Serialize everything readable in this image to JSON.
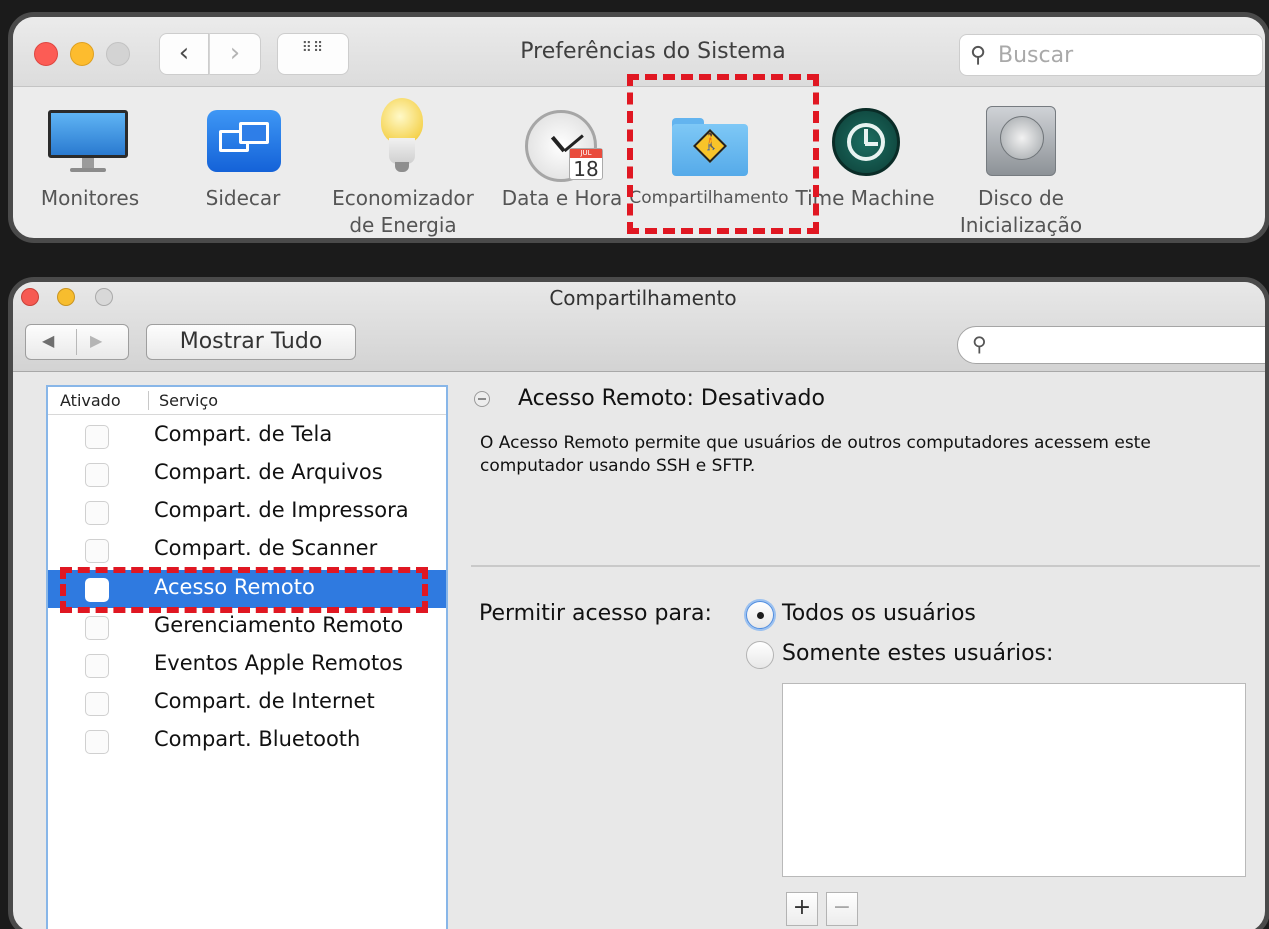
{
  "system_prefs": {
    "title": "Preferências do Sistema",
    "search_placeholder": "Buscar",
    "nav_back": "‹",
    "nav_forward": "›",
    "grid_glyph": "⠿⠿",
    "items": [
      {
        "label": "Monitores"
      },
      {
        "label": "Sidecar"
      },
      {
        "label": "Economizador de Energia"
      },
      {
        "label": "Data e Hora",
        "calendar_month": "JUL",
        "calendar_day": "18"
      },
      {
        "label": "Compartilhamento"
      },
      {
        "label": "Time Machine"
      },
      {
        "label": "Disco de Inicialização"
      }
    ]
  },
  "sharing_window": {
    "title": "Compartilhamento",
    "show_all": "Mostrar Tudo",
    "back_arrow": "◀",
    "forward_arrow": "▶",
    "columns": {
      "enabled": "Ativado",
      "service": "Serviço"
    },
    "services": [
      {
        "label": "Compart. de Tela",
        "checked": false
      },
      {
        "label": "Compart. de Arquivos",
        "checked": false
      },
      {
        "label": "Compart. de Impressora",
        "checked": false
      },
      {
        "label": "Compart. de Scanner",
        "checked": false
      },
      {
        "label": "Acesso Remoto",
        "checked": false,
        "selected": true
      },
      {
        "label": "Gerenciamento Remoto",
        "checked": false
      },
      {
        "label": "Eventos Apple Remotos",
        "checked": false
      },
      {
        "label": "Compart. de Internet",
        "checked": false
      },
      {
        "label": "Compart. Bluetooth",
        "checked": false
      }
    ],
    "detail": {
      "status_title": "Acesso Remoto: Desativado",
      "description": "O Acesso Remoto permite que usuários de outros computadores acessem este computador usando SSH e SFTP.",
      "access_label": "Permitir acesso para:",
      "option_all": "Todos os usuários",
      "option_only": "Somente estes usuários:",
      "selected_option": "Todos os usuários",
      "add_label": "+",
      "remove_label": "−"
    }
  },
  "colors": {
    "highlight": "#e01722",
    "selection": "#2f7ae0"
  }
}
